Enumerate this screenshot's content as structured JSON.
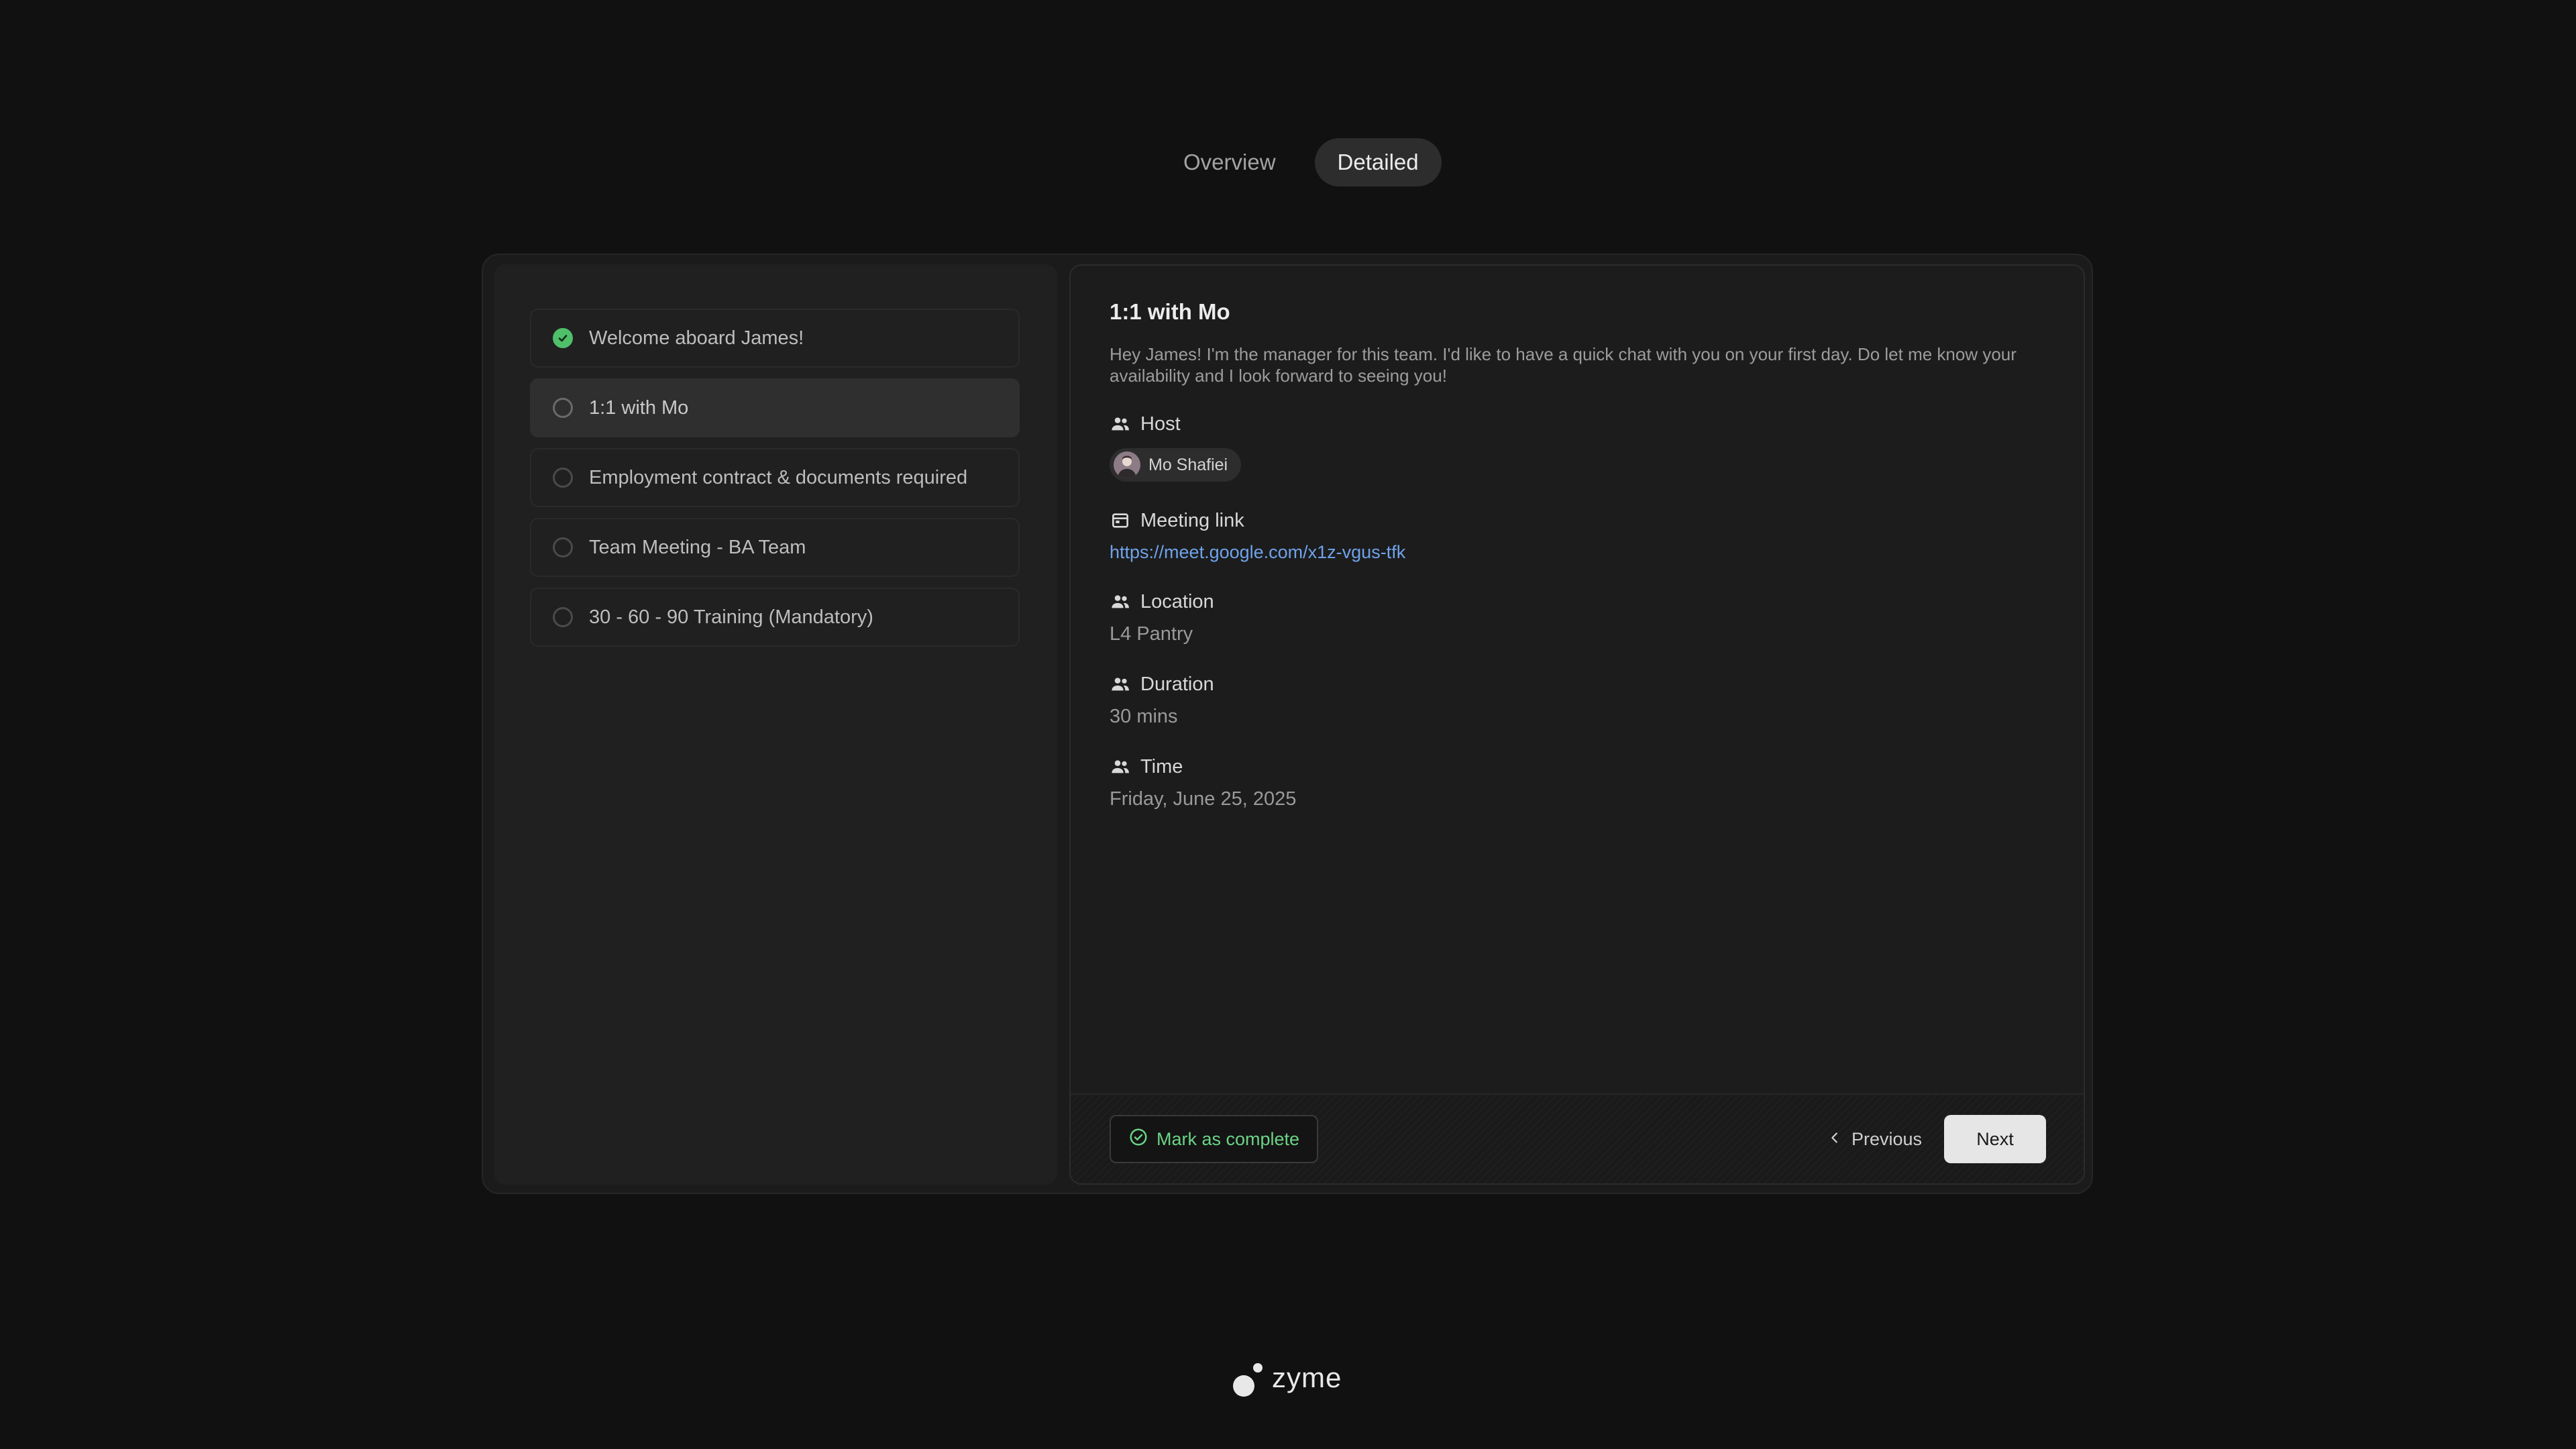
{
  "tabs": [
    {
      "label": "Overview",
      "active": false
    },
    {
      "label": "Detailed",
      "active": true
    }
  ],
  "steps": [
    {
      "label": "Welcome aboard James!",
      "status": "done"
    },
    {
      "label": "1:1 with Mo",
      "status": "active"
    },
    {
      "label": "Employment contract & documents required",
      "status": "todo"
    },
    {
      "label": "Team Meeting - BA Team",
      "status": "todo"
    },
    {
      "label": "30 - 60 - 90 Training (Mandatory)",
      "status": "todo"
    }
  ],
  "detail": {
    "title": "1:1 with Mo",
    "description": "Hey James! I'm the manager for this team. I'd like to have a quick chat with you on your first day. Do let me know your availability and I look forward to seeing you!",
    "host": {
      "label": "Host",
      "name": "Mo Shafiei",
      "icon": "people-icon"
    },
    "meeting_link": {
      "label": "Meeting link",
      "url": "https://meet.google.com/x1z-vgus-tfk",
      "icon": "calendar-icon"
    },
    "location": {
      "label": "Location",
      "value": "L4 Pantry",
      "icon": "people-icon"
    },
    "duration": {
      "label": "Duration",
      "value": "30 mins",
      "icon": "people-icon"
    },
    "time": {
      "label": "Time",
      "value": "Friday, June 25, 2025",
      "icon": "people-icon"
    }
  },
  "footer": {
    "complete_label": "Mark as complete",
    "previous_label": "Previous",
    "next_label": "Next"
  },
  "brand": {
    "name": "zyme"
  },
  "colors": {
    "background": "#111111",
    "success": "#4fbf6a",
    "link": "#6fa3ea",
    "primary_button": "#e6e6e6"
  }
}
